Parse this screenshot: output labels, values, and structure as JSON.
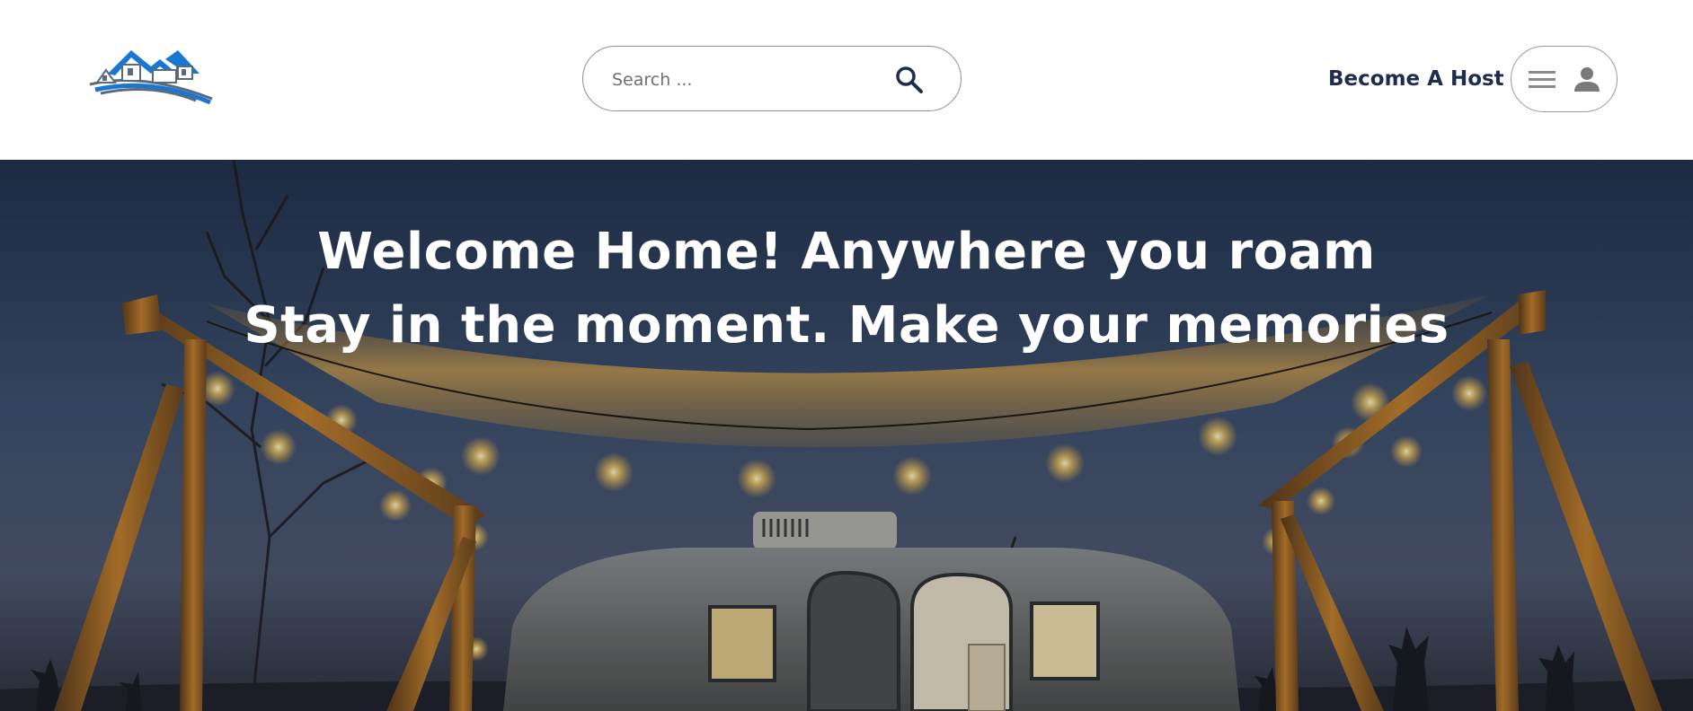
{
  "header": {
    "logo_icon": "house-rooftops-logo-icon",
    "search": {
      "placeholder": "Search ...",
      "value": "",
      "icon": "search-icon"
    },
    "host_link_label": "Become A Host",
    "user_menu": {
      "menu_icon": "hamburger-menu-icon",
      "user_icon": "user-icon"
    }
  },
  "hero": {
    "line1": "Welcome Home! Anywhere you roam",
    "line2": "Stay in the moment. Make your memories",
    "image_subject": "airstream-trailer-under-string-lights-at-dusk"
  },
  "colors": {
    "brand_blue": "#1976d2",
    "logo_gray": "#5a6a7a",
    "host_text": "#1e2d4f",
    "search_icon": "#1e2d4f",
    "hero_overlay": "#1e2a40"
  }
}
